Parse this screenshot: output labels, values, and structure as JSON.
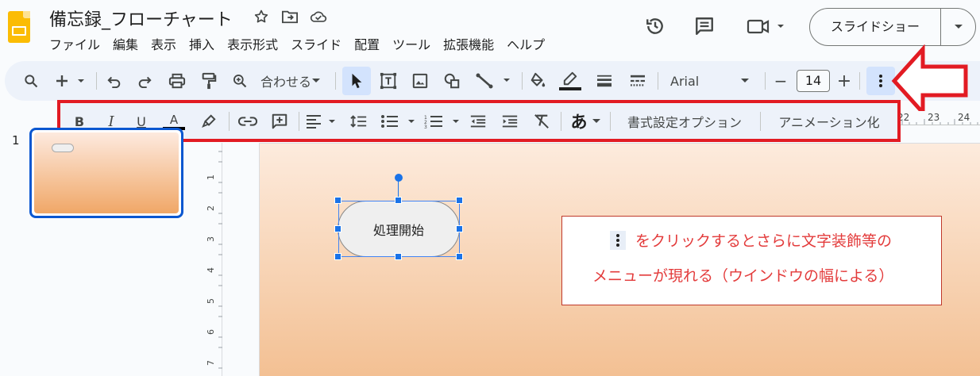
{
  "document": {
    "title": "備忘録_フローチャート"
  },
  "menu": [
    "ファイル",
    "編集",
    "表示",
    "挿入",
    "表示形式",
    "スライド",
    "配置",
    "ツール",
    "拡張機能",
    "ヘルプ"
  ],
  "header": {
    "slideshow_label": "スライドショー"
  },
  "toolbar": {
    "zoom_label": "合わせる",
    "font_name": "Arial",
    "font_size": "14",
    "minus": "−",
    "plus": "+"
  },
  "subbar": {
    "bold": "B",
    "italic": "I",
    "underline": "U",
    "text_color": "A",
    "hiragana": "あ",
    "format_options": "書式設定オプション",
    "animation": "アニメーション化"
  },
  "ruler": {
    "top": [
      "22",
      "23",
      "24"
    ],
    "left": [
      "1",
      "2",
      "3",
      "4",
      "5",
      "6",
      "7"
    ]
  },
  "slides": {
    "current_number": "1"
  },
  "canvas": {
    "shape_text": "処理開始",
    "note_line1": "をクリックするとさらに文字装飾等の",
    "note_line2": "メニューが現れる（ウインドウの幅による）"
  },
  "colors": {
    "accent_red": "#e21b23",
    "selection_blue": "#1a73e8",
    "toolbar_bg": "#edf2fa"
  }
}
